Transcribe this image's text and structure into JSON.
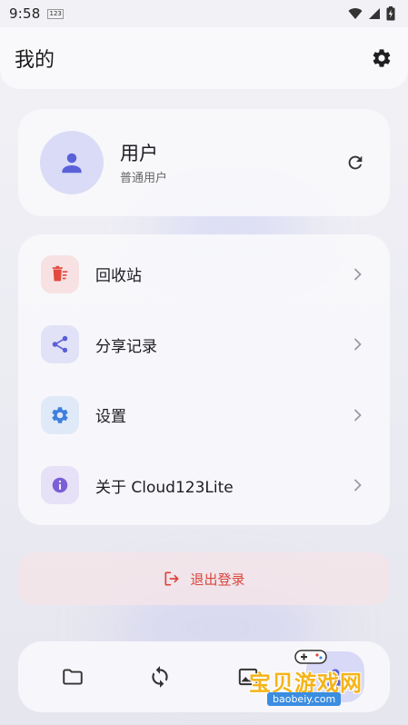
{
  "status_bar": {
    "time": "9:58",
    "badge": "123"
  },
  "header": {
    "title": "我的",
    "settings_icon": "gear-icon"
  },
  "profile": {
    "name": "用户",
    "role": "普通用户",
    "avatar_icon": "person-icon",
    "refresh_icon": "refresh-icon"
  },
  "menu": {
    "items": [
      {
        "label": "回收站",
        "icon": "trash-icon",
        "icon_color": "#e2483d",
        "bg": "#f7e1e2"
      },
      {
        "label": "分享记录",
        "icon": "share-icon",
        "icon_color": "#5a5fd6",
        "bg": "#e1e2f7"
      },
      {
        "label": "设置",
        "icon": "gear-icon",
        "icon_color": "#3f7fdc",
        "bg": "#dfe9f8"
      },
      {
        "label": "关于 Cloud123Lite",
        "icon": "info-icon",
        "icon_color": "#7b5fd6",
        "bg": "#e6e1f7"
      }
    ]
  },
  "logout": {
    "label": "退出登录",
    "icon": "logout-icon",
    "color": "#d9453b"
  },
  "bottom_nav": {
    "items": [
      {
        "icon": "folder-icon"
      },
      {
        "icon": "sync-icon"
      },
      {
        "icon": "image-icon"
      },
      {
        "icon": "profile-icon"
      }
    ]
  },
  "watermark": {
    "text": "宝贝游戏网",
    "url": "baobeiy.com"
  },
  "colors": {
    "accent": "#5b62d8",
    "danger": "#d9453b"
  }
}
